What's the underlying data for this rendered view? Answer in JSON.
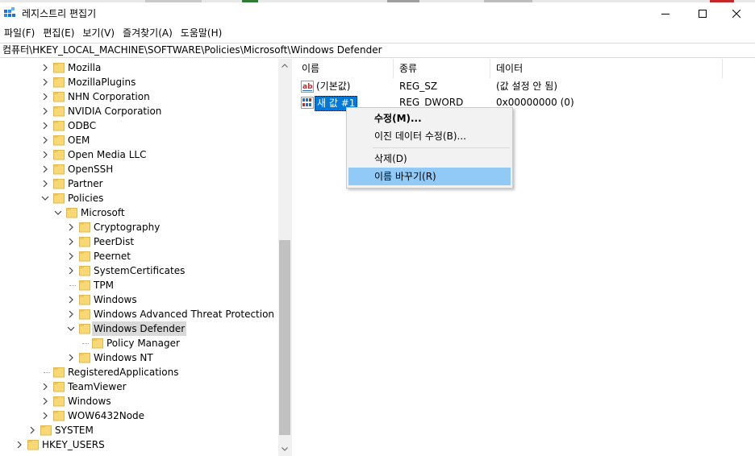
{
  "window": {
    "title": "레지스트리 편집기"
  },
  "menu": [
    "파일(F)",
    "편집(E)",
    "보기(V)",
    "즐겨찾기(A)",
    "도움말(H)"
  ],
  "address": "컴퓨터\\HKEY_LOCAL_MACHINE\\SOFTWARE\\Policies\\Microsoft\\Windows Defender",
  "tree": {
    "items": [
      {
        "label": "Mozilla",
        "level": 3,
        "expander": "collapsed"
      },
      {
        "label": "MozillaPlugins",
        "level": 3,
        "expander": "collapsed"
      },
      {
        "label": "NHN Corporation",
        "level": 3,
        "expander": "collapsed"
      },
      {
        "label": "NVIDIA Corporation",
        "level": 3,
        "expander": "collapsed"
      },
      {
        "label": "ODBC",
        "level": 3,
        "expander": "collapsed"
      },
      {
        "label": "OEM",
        "level": 3,
        "expander": "collapsed"
      },
      {
        "label": "Open Media LLC",
        "level": 3,
        "expander": "collapsed"
      },
      {
        "label": "OpenSSH",
        "level": 3,
        "expander": "collapsed"
      },
      {
        "label": "Partner",
        "level": 3,
        "expander": "collapsed"
      },
      {
        "label": "Policies",
        "level": 3,
        "expander": "expanded"
      },
      {
        "label": "Microsoft",
        "level": 4,
        "expander": "expanded"
      },
      {
        "label": "Cryptography",
        "level": 5,
        "expander": "collapsed"
      },
      {
        "label": "PeerDist",
        "level": 5,
        "expander": "collapsed"
      },
      {
        "label": "Peernet",
        "level": 5,
        "expander": "collapsed"
      },
      {
        "label": "SystemCertificates",
        "level": 5,
        "expander": "collapsed"
      },
      {
        "label": "TPM",
        "level": 5,
        "expander": "none"
      },
      {
        "label": "Windows",
        "level": 5,
        "expander": "collapsed"
      },
      {
        "label": "Windows Advanced Threat Protection",
        "level": 5,
        "expander": "collapsed"
      },
      {
        "label": "Windows Defender",
        "level": 5,
        "expander": "expanded",
        "selected": true
      },
      {
        "label": "Policy Manager",
        "level": 6,
        "expander": "none"
      },
      {
        "label": "Windows NT",
        "level": 5,
        "expander": "collapsed"
      },
      {
        "label": "RegisteredApplications",
        "level": 3,
        "expander": "none"
      },
      {
        "label": "TeamViewer",
        "level": 3,
        "expander": "collapsed"
      },
      {
        "label": "Windows",
        "level": 3,
        "expander": "collapsed"
      },
      {
        "label": "WOW6432Node",
        "level": 3,
        "expander": "collapsed"
      },
      {
        "label": "SYSTEM",
        "level": 2,
        "expander": "collapsed"
      },
      {
        "label": "HKEY_USERS",
        "level": 1,
        "expander": "collapsed"
      }
    ]
  },
  "columns": [
    "이름",
    "종류",
    "데이터"
  ],
  "values": [
    {
      "icon": "string-value-icon",
      "name": "(기본값)",
      "type": "REG_SZ",
      "data": "(값 설정 안 됨)"
    },
    {
      "icon": "dword-value-icon",
      "name": "새 값 #1",
      "type": "REG_DWORD",
      "data": "0x00000000 (0)",
      "editing": true
    }
  ],
  "context_menu": {
    "items": [
      {
        "label": "수정(M)...",
        "bold": true
      },
      {
        "label": "이진 데이터 수정(B)..."
      },
      {
        "separator": true
      },
      {
        "label": "삭제(D)"
      },
      {
        "label": "이름 바꾸기(R)",
        "hover": true
      }
    ]
  },
  "colors": {
    "folder": "#f8d775",
    "folder_dark": "#e0b84a",
    "selection_edit": "#0078d7",
    "menu_hover": "#91c9f7",
    "tree_selected": "#d9d9d9"
  }
}
